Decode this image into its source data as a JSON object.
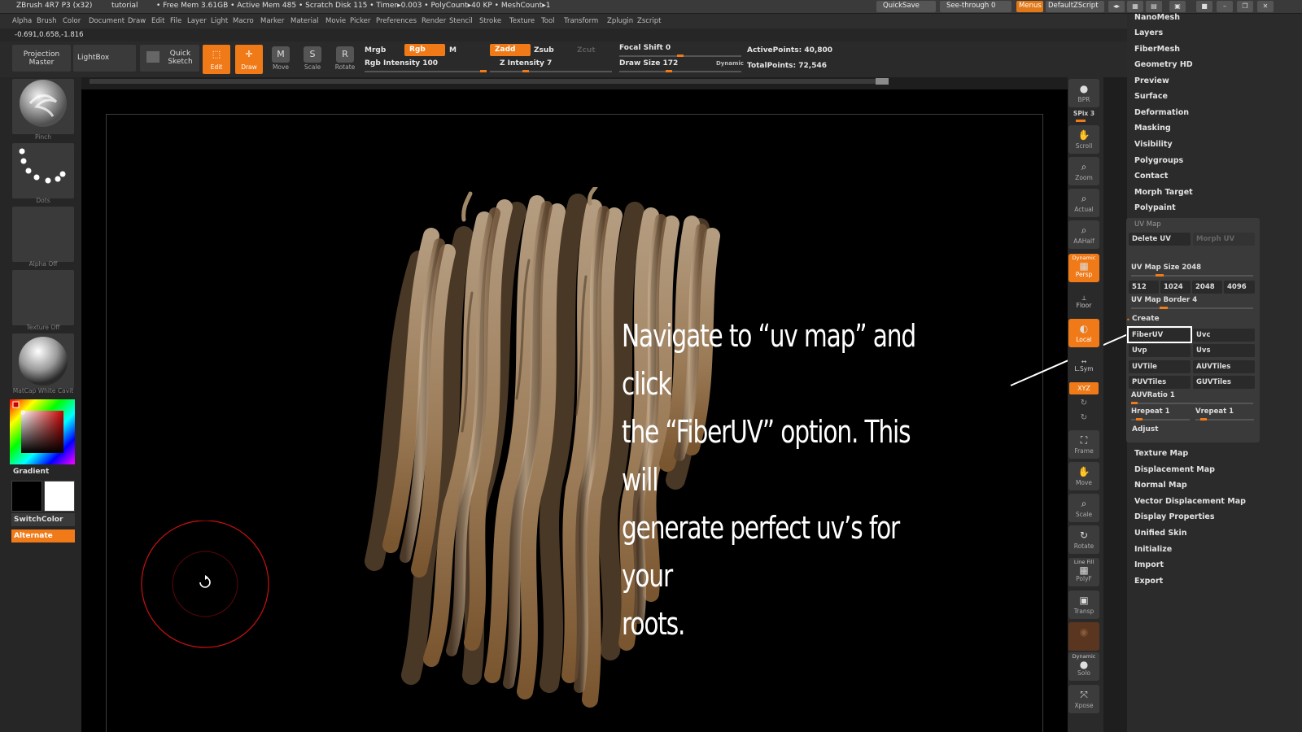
{
  "titlebar": {
    "app": "ZBrush 4R7 P3 (x32)",
    "doc": "tutorial",
    "stats": "• Free Mem 3.61GB • Active Mem 485 • Scratch Disk 115 • Timer▸0.003 • PolyCount▸40 KP • MeshCount▸1",
    "quicksave": "QuickSave",
    "seethrough": "See-through  0",
    "menus": "Menus",
    "script": "DefaultZScript"
  },
  "menubar": [
    "Alpha",
    "Brush",
    "Color",
    "Document",
    "Draw",
    "Edit",
    "File",
    "Layer",
    "Light",
    "Macro",
    "Marker",
    "Material",
    "Movie",
    "Picker",
    "Preferences",
    "Render",
    "Stencil",
    "Stroke",
    "Texture",
    "Tool",
    "Transform",
    "Zplugin",
    "Zscript"
  ],
  "coords": "-0.691,0.658,-1.816",
  "toolbar": {
    "projection_master": "Projection Master",
    "lightbox": "LightBox",
    "quick_sketch": "Quick Sketch",
    "edit": "Edit",
    "draw": "Draw",
    "move": "Move",
    "scale": "Scale",
    "rotate": "Rotate",
    "mrgb": "Mrgb",
    "rgb": "Rgb",
    "m": "M",
    "rgb_intensity": "Rgb Intensity 100",
    "zadd": "Zadd",
    "zsub": "Zsub",
    "zcut": "Zcut",
    "z_intensity": "Z Intensity 7",
    "focal_shift": "Focal Shift 0",
    "draw_size": "Draw Size 172",
    "dynamic": "Dynamic",
    "active_points": "ActivePoints: 40,800",
    "total_points": "TotalPoints: 72,546"
  },
  "leftshelf": {
    "brush": "Pinch",
    "stroke": "Dots",
    "alpha": "Alpha  Off",
    "texture": "Texture  Off",
    "material": "MatCap  White  Cavit",
    "gradient": "Gradient",
    "switchcolor": "SwitchColor",
    "alternate": "Alternate"
  },
  "annotation": "Navigate to “uv map” and click\nthe “FiberUV” option. This will\ngenerate perfect uv’s for your\nroots.",
  "rightshelf": {
    "bpr": "BPR",
    "spix": "SPix 3",
    "scroll": "Scroll",
    "zoom": "Zoom",
    "actual": "Actual",
    "aahalf": "AAHalf",
    "dynamic": "Dynamic",
    "persp": "Persp",
    "floor": "Floor",
    "local": "Local",
    "lsym": "L.Sym",
    "xyz": "XYZ",
    "frame": "Frame",
    "move": "Move",
    "scale": "Scale",
    "rotate": "Rotate",
    "linefill": "Line Fill",
    "polyf": "PolyF",
    "transp": "Transp",
    "ghost": "Ghost",
    "dynamic2": "Dynamic",
    "solo": "Solo",
    "xpose": "Xpose"
  },
  "palette": {
    "top_items": [
      "NanoMesh",
      "Layers",
      "FiberMesh",
      "Geometry HD",
      "Preview",
      "Surface",
      "Deformation",
      "Masking",
      "Visibility",
      "Polygroups",
      "Contact",
      "Morph Target",
      "Polypaint"
    ],
    "uvmap": {
      "title": "UV Map",
      "delete_uv": "Delete UV",
      "morph_uv": "Morph UV",
      "size_label": "UV Map Size 2048",
      "sizes": [
        "512",
        "1024",
        "2048",
        "4096"
      ],
      "border_label": "UV Map Border 4",
      "create": "Create",
      "buttons": [
        "FiberUV",
        "Uvc",
        "Uvp",
        "Uvs",
        "UVTile",
        "AUVTiles",
        "PUVTiles",
        "GUVTiles"
      ],
      "auvratio": "AUVRatio 1",
      "hrepeat": "Hrepeat 1",
      "vrepeat": "Vrepeat 1",
      "adjust": "Adjust"
    },
    "bottom_items": [
      "Texture Map",
      "Displacement Map",
      "Normal Map",
      "Vector Displacement Map",
      "Display Properties",
      "Unified Skin",
      "Initialize",
      "Import",
      "Export"
    ]
  },
  "colors": {
    "accent": "#f07a18",
    "annotation_text": "#ffffff",
    "root_base": "#a4896b",
    "brush_ring": "#cc1111"
  }
}
